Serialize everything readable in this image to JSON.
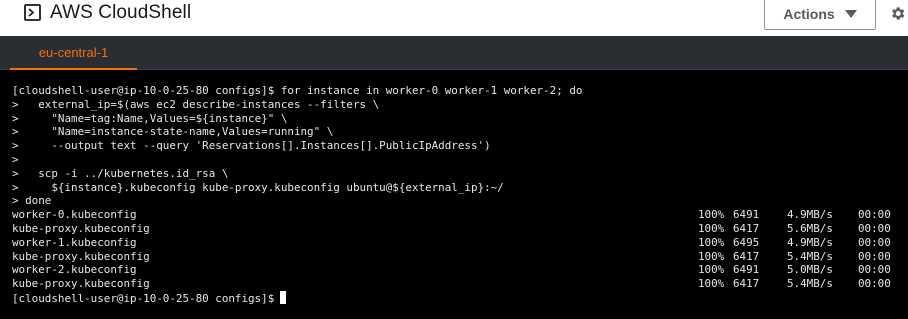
{
  "header": {
    "title": "AWS CloudShell",
    "actions_label": "Actions"
  },
  "tabs": [
    {
      "label": "eu-central-1",
      "active": true
    }
  ],
  "colors": {
    "accent": "#ec7211",
    "terminal_bg": "#000000",
    "terminal_fg": "#e6e6e6"
  },
  "icons": {
    "app": "terminal-icon",
    "actions_caret": "caret-down-icon",
    "settings": "gear-icon"
  },
  "terminal": {
    "command_lines": [
      "[cloudshell-user@ip-10-0-25-80 configs]$ for instance in worker-0 worker-1 worker-2; do",
      ">   external_ip=$(aws ec2 describe-instances --filters \\",
      ">     \"Name=tag:Name,Values=${instance}\" \\",
      ">     \"Name=instance-state-name,Values=running\" \\",
      ">     --output text --query 'Reservations[].Instances[].PublicIpAddress')",
      ">",
      ">   scp -i ../kubernetes.id_rsa \\",
      ">     ${instance}.kubeconfig kube-proxy.kubeconfig ubuntu@${external_ip}:~/",
      "> done"
    ],
    "transfers": [
      {
        "file": "worker-0.kubeconfig",
        "percent": "100%",
        "size": "6491",
        "rate": "4.9MB/s",
        "eta": "00:00"
      },
      {
        "file": "kube-proxy.kubeconfig",
        "percent": "100%",
        "size": "6417",
        "rate": "5.6MB/s",
        "eta": "00:00"
      },
      {
        "file": "worker-1.kubeconfig",
        "percent": "100%",
        "size": "6495",
        "rate": "4.9MB/s",
        "eta": "00:00"
      },
      {
        "file": "kube-proxy.kubeconfig",
        "percent": "100%",
        "size": "6417",
        "rate": "5.4MB/s",
        "eta": "00:00"
      },
      {
        "file": "worker-2.kubeconfig",
        "percent": "100%",
        "size": "6491",
        "rate": "5.0MB/s",
        "eta": "00:00"
      },
      {
        "file": "kube-proxy.kubeconfig",
        "percent": "100%",
        "size": "6417",
        "rate": "5.4MB/s",
        "eta": "00:00"
      }
    ],
    "prompt": "[cloudshell-user@ip-10-0-25-80 configs]$"
  }
}
